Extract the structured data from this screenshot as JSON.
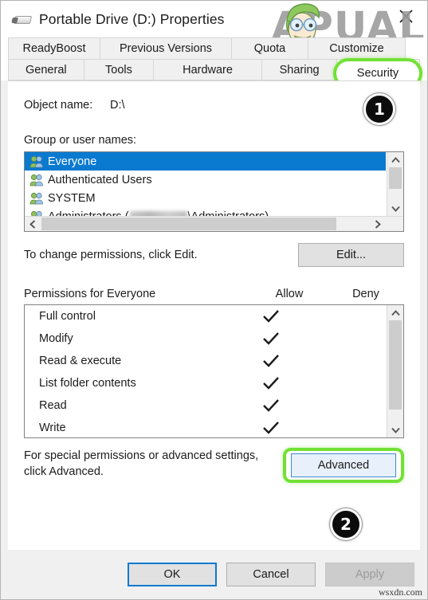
{
  "window": {
    "title": "Portable Drive (D:) Properties",
    "drive_icon": "portable-drive-icon",
    "close_icon": "close-icon"
  },
  "watermark": {
    "brand": "APUALS",
    "bottom": "wsxdn.com"
  },
  "tabs": {
    "row1": [
      {
        "label": "ReadyBoost",
        "selected": false
      },
      {
        "label": "Previous Versions",
        "selected": false
      },
      {
        "label": "Quota",
        "selected": false
      },
      {
        "label": "Customize",
        "selected": false
      }
    ],
    "row2": [
      {
        "label": "General",
        "selected": false
      },
      {
        "label": "Tools",
        "selected": false
      },
      {
        "label": "Hardware",
        "selected": false
      },
      {
        "label": "Sharing",
        "selected": false
      },
      {
        "label": "Security",
        "selected": true
      }
    ],
    "highlighted": "Security"
  },
  "object": {
    "label": "Object name:",
    "value": "D:\\"
  },
  "groups": {
    "label": "Group or user names:",
    "items": [
      {
        "name": "Everyone",
        "selected": true,
        "redacted": false
      },
      {
        "name": "Authenticated Users",
        "selected": false,
        "redacted": false
      },
      {
        "name": "SYSTEM",
        "selected": false,
        "redacted": false
      },
      {
        "name": "Administrators (",
        "suffix": "\\Administrators)",
        "selected": false,
        "redacted": true
      }
    ]
  },
  "edit": {
    "hint": "To change permissions, click Edit.",
    "button_label": "Edit..."
  },
  "permissions": {
    "header_title": "Permissions for Everyone",
    "header_allow": "Allow",
    "header_deny": "Deny",
    "rows": [
      {
        "name": "Full control",
        "allow": true,
        "deny": false
      },
      {
        "name": "Modify",
        "allow": true,
        "deny": false
      },
      {
        "name": "Read & execute",
        "allow": true,
        "deny": false
      },
      {
        "name": "List folder contents",
        "allow": true,
        "deny": false
      },
      {
        "name": "Read",
        "allow": true,
        "deny": false
      },
      {
        "name": "Write",
        "allow": true,
        "deny": false
      }
    ]
  },
  "advanced": {
    "hint_line1": "For special permissions or advanced settings,",
    "hint_line2": "click Advanced.",
    "button_label": "Advanced"
  },
  "badges": {
    "one": "1",
    "two": "2"
  },
  "footer": {
    "ok": "OK",
    "cancel": "Cancel",
    "apply": "Apply"
  },
  "colors": {
    "selection_blue": "#0a7ad0",
    "highlight_green": "#72e136",
    "button_face": "#e1e1e1",
    "dialog_face": "#f0f0f0"
  }
}
